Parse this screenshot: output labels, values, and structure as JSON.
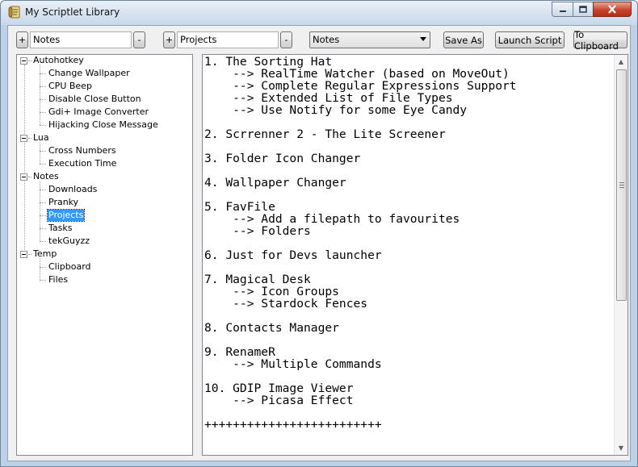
{
  "window": {
    "title": "My Scriptlet Library"
  },
  "toolbar": {
    "add1_label": "+",
    "category_value": "Notes",
    "remove1_label": "-",
    "add2_label": "+",
    "item_value": "Projects",
    "remove2_label": "-",
    "dropdown_selected": "Notes",
    "save_as_label": "Save As",
    "launch_label": "Launch Script",
    "clipboard_label": "To Clipboard"
  },
  "tree": {
    "groups": [
      {
        "label": "Autohotkey",
        "children": [
          "Change Wallpaper",
          "CPU Beep",
          "Disable Close Button",
          "Gdi+ Image Converter",
          "Hijacking Close Message"
        ]
      },
      {
        "label": "Lua",
        "children": [
          "Cross Numbers",
          "Execution Time"
        ]
      },
      {
        "label": "Notes",
        "children": [
          "Downloads",
          "Pranky",
          "Projects",
          "Tasks",
          "tekGuyzz"
        ]
      },
      {
        "label": "Temp",
        "children": [
          "Clipboard",
          "Files"
        ]
      }
    ],
    "selected": "Projects"
  },
  "editor": {
    "text": "1. The Sorting Hat\n    --> RealTime Watcher (based on MoveOut)\n    --> Complete Regular Expressions Support\n    --> Extended List of File Types\n    --> Use Notify for some Eye Candy\n\n2. Scrrenner 2 - The Lite Screener\n\n3. Folder Icon Changer\n\n4. Wallpaper Changer\n\n5. FavFile\n    --> Add a filepath to favourites\n    --> Folders\n\n6. Just for Devs launcher\n\n7. Magical Desk\n    --> Icon Groups\n    --> Stardock Fences\n\n8. Contacts Manager\n\n9. RenameR\n    --> Multiple Commands\n\n10. GDIP Image Viewer\n    --> Picasa Effect\n\n+++++++++++++++++++++++++"
  },
  "icons": {
    "app": "scroll-notes-icon",
    "minimize": "minimize-icon",
    "maximize": "maximize-icon",
    "close": "close-icon"
  }
}
